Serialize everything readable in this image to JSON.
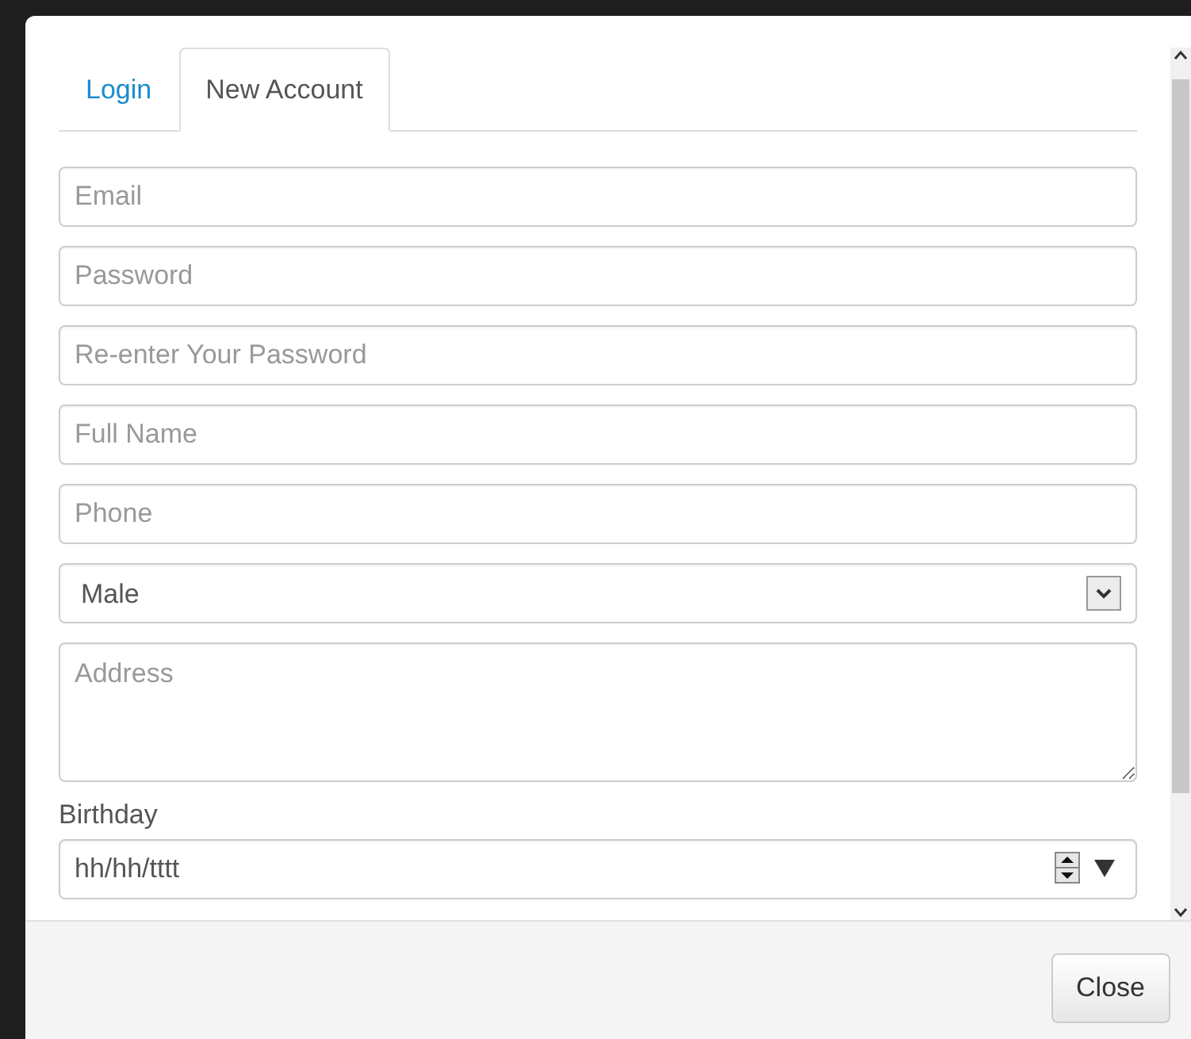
{
  "tabs": [
    {
      "label": "Login",
      "selected": false
    },
    {
      "label": "New Account",
      "selected": true
    }
  ],
  "fields": [
    {
      "kind": "text",
      "placeholder": "Email"
    },
    {
      "kind": "text",
      "placeholder": "Password"
    },
    {
      "kind": "text",
      "placeholder": "Re-enter Your Password"
    },
    {
      "kind": "text",
      "placeholder": "Full Name"
    },
    {
      "kind": "text",
      "placeholder": "Phone"
    },
    {
      "kind": "select",
      "value": "Male"
    },
    {
      "kind": "textarea",
      "placeholder": "Address"
    },
    {
      "kind": "date",
      "label": "Birthday",
      "placeholder": "hh/hh/tttt"
    }
  ],
  "buttons": [
    "Close"
  ]
}
